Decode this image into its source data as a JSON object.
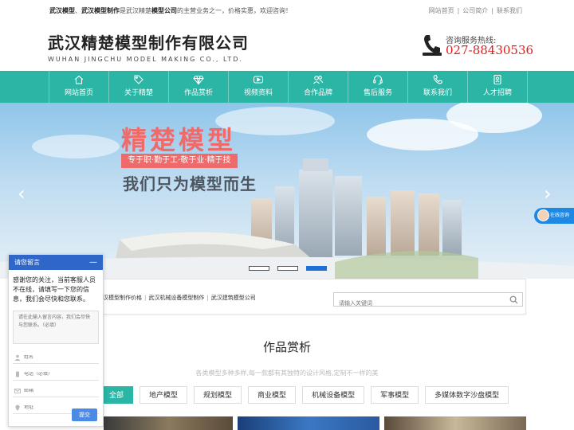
{
  "topbar": {
    "intro_b1": "武汉模型",
    "intro_sep1": "、",
    "intro_b2": "武汉模型制作",
    "intro_t1": "是武汉精楚",
    "intro_b3": "模型公司",
    "intro_t2": "的主营业务之一，价格实惠，欢迎咨询！",
    "links": [
      "网站首页",
      "公司简介",
      "联系我们"
    ]
  },
  "logo": {
    "cn": "武汉精楚模型制作有限公司",
    "en": "WUHAN JINGCHU MODEL MAKING CO., LTD."
  },
  "hotline": {
    "label": "咨询服务热线:",
    "number": "027-88430536"
  },
  "nav": {
    "items": [
      {
        "label": "网站首页",
        "icon": "home-icon"
      },
      {
        "label": "关于精楚",
        "icon": "tag-icon"
      },
      {
        "label": "作品赏析",
        "icon": "diamond-icon"
      },
      {
        "label": "视频资料",
        "icon": "video-icon"
      },
      {
        "label": "合作品牌",
        "icon": "users-icon"
      },
      {
        "label": "售后服务",
        "icon": "headset-icon"
      },
      {
        "label": "联系我们",
        "icon": "phone-icon"
      },
      {
        "label": "人才招聘",
        "icon": "document-icon"
      }
    ]
  },
  "banner": {
    "slogan1": "精楚模型",
    "slogan2": "专于职·勤于工·敬于业·精于技",
    "slogan3": "我们只为模型而生",
    "prev": "‹",
    "next": "›",
    "active_slide": 3
  },
  "online": {
    "label": "在线咨询"
  },
  "keywords": {
    "items": [
      "汉模型制作价格",
      "武汉机械设备模型制作",
      "武汉建筑模型公司"
    ],
    "search_placeholder": "请输入关键词"
  },
  "section": {
    "title": "作品赏析",
    "subtitle": "各类模型多种多样,每一款都有其独特的设计风格,定制不一样的美",
    "tabs": [
      "全部",
      "地产模型",
      "规划模型",
      "商业模型",
      "机械设备模型",
      "军事模型",
      "多媒体数字沙盘模型"
    ],
    "active_tab": 0
  },
  "chat": {
    "title": "请您留言",
    "minimize": "—",
    "message": "感谢您的关注，当前客服人员不在线，请填写一下您的信息，我们会尽快和您联系。",
    "textarea_placeholder": "请在此输入留言内容，我们会尽快与您联系。（必填）",
    "name_placeholder": "姓名",
    "phone_placeholder": "电话（必填）",
    "email_placeholder": "邮箱",
    "address_placeholder": "地址",
    "submit": "提交"
  },
  "colors": {
    "accent": "#2ab5a5",
    "brand_red": "#e21c1c",
    "chat_blue": "#2f67c8"
  }
}
